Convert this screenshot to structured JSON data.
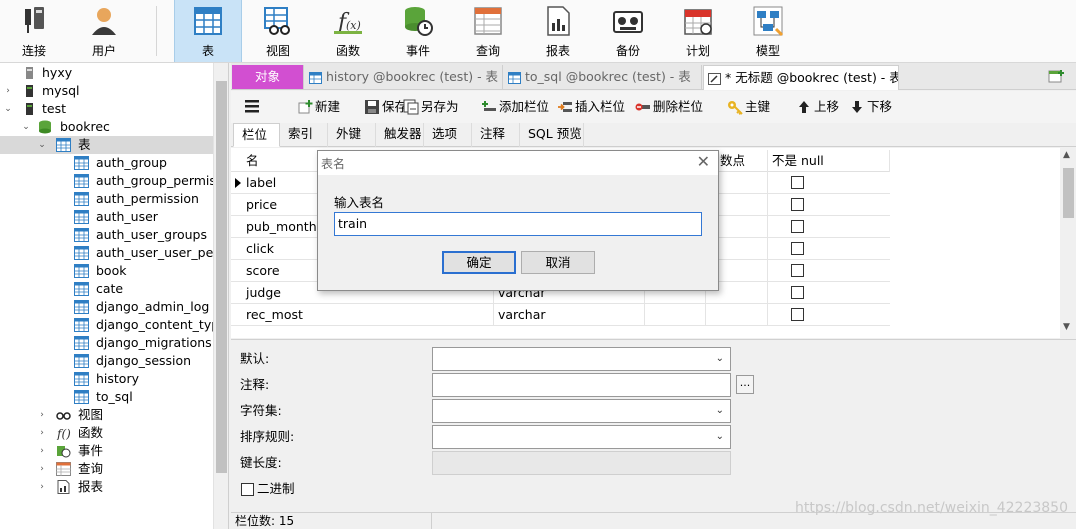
{
  "toolbar": {
    "items": [
      {
        "label": "连接",
        "icon": "connection-icon"
      },
      {
        "label": "用户",
        "icon": "user-icon"
      },
      {
        "label": "表",
        "icon": "table-icon"
      },
      {
        "label": "视图",
        "icon": "view-icon"
      },
      {
        "label": "函数",
        "icon": "function-icon"
      },
      {
        "label": "事件",
        "icon": "event-icon"
      },
      {
        "label": "查询",
        "icon": "query-icon"
      },
      {
        "label": "报表",
        "icon": "report-icon"
      },
      {
        "label": "备份",
        "icon": "backup-icon"
      },
      {
        "label": "计划",
        "icon": "schedule-icon"
      },
      {
        "label": "模型",
        "icon": "model-icon"
      }
    ]
  },
  "tree": {
    "connections": [
      "hyxy",
      "mysql",
      "test"
    ],
    "database": "bookrec",
    "tables_label": "表",
    "tables": [
      "auth_group",
      "auth_group_permiss",
      "auth_permission",
      "auth_user",
      "auth_user_groups",
      "auth_user_user_pern",
      "book",
      "cate",
      "django_admin_log",
      "django_content_type",
      "django_migrations",
      "django_session",
      "history",
      "to_sql"
    ],
    "groups": [
      "视图",
      "函数",
      "事件",
      "查询",
      "报表"
    ]
  },
  "tabs": {
    "objects": "对象",
    "tab1": "history @bookrec (test) - 表",
    "tab2": "to_sql @bookrec (test) - 表",
    "tab3": "* 无标题 @bookrec (test) - 表"
  },
  "editor_toolbar": {
    "new": "新建",
    "save": "保存",
    "save_as": "另存为",
    "add_field": "添加栏位",
    "insert_field": "插入栏位",
    "delete_field": "删除栏位",
    "primary_key": "主键",
    "move_up": "上移",
    "move_down": "下移"
  },
  "subtabs": [
    "栏位",
    "索引",
    "外键",
    "触发器",
    "选项",
    "注释",
    "SQL 预览"
  ],
  "grid": {
    "headers": {
      "name": "名",
      "decimals": "数点",
      "not_null": "不是 null"
    },
    "rows": [
      {
        "name": "label",
        "type": ""
      },
      {
        "name": "price",
        "type": ""
      },
      {
        "name": "pub_month",
        "type": ""
      },
      {
        "name": "click",
        "type": ""
      },
      {
        "name": "score",
        "type": ""
      },
      {
        "name": "judge",
        "type": "varchar"
      },
      {
        "name": "rec_most",
        "type": "varchar"
      }
    ]
  },
  "props": {
    "default": "默认:",
    "comment": "注释:",
    "charset": "字符集:",
    "collation": "排序规则:",
    "key_length": "键长度:",
    "binary": "二进制",
    "ellipsis": "..."
  },
  "status": {
    "field_count": "栏位数: 15"
  },
  "watermark": "https://blog.csdn.net/weixin_42223850",
  "dialog": {
    "title": "表名",
    "prompt": "输入表名",
    "value": "train",
    "ok": "确定",
    "cancel": "取消"
  }
}
